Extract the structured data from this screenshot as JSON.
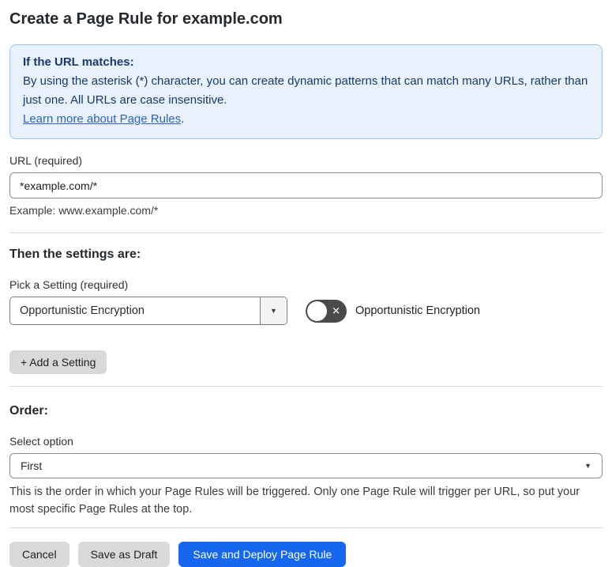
{
  "page": {
    "title": "Create a Page Rule for example.com"
  },
  "info_box": {
    "heading": "If the URL matches:",
    "body": "By using the asterisk (*) character, you can create dynamic patterns that can match many URLs, rather than just one. All URLs are case insensitive.",
    "link_label": "Learn more about Page Rules",
    "link_suffix": "."
  },
  "url_field": {
    "label": "URL (required)",
    "value": "*example.com/*",
    "helper": "Example: www.example.com/*"
  },
  "settings_section": {
    "heading": "Then the settings are:",
    "picker_label": "Pick a Setting (required)",
    "picker_value": "Opportunistic Encryption",
    "toggle_state": "off",
    "toggle_label": "Opportunistic Encryption",
    "add_button_label": "+ Add a Setting"
  },
  "order_section": {
    "heading": "Order:",
    "select_label": "Select option",
    "select_value": "First",
    "description": "This is the order in which your Page Rules will be triggered. Only one Page Rule will trigger per URL, so put your most specific Page Rules at the top."
  },
  "footer": {
    "cancel_label": "Cancel",
    "save_draft_label": "Save as Draft",
    "save_deploy_label": "Save and Deploy Page Rule"
  },
  "icons": {
    "caret_down": "▼",
    "toggle_x": "✕"
  },
  "colors": {
    "info_bg": "#e9f2fc",
    "info_border": "#9cc3e8",
    "info_text": "#17396f",
    "link_blue": "#2b61c7",
    "primary_button_blue": "#1667f0",
    "toggle_off_gray": "#4a4a4a",
    "secondary_button_gray": "#d9d9d9"
  }
}
